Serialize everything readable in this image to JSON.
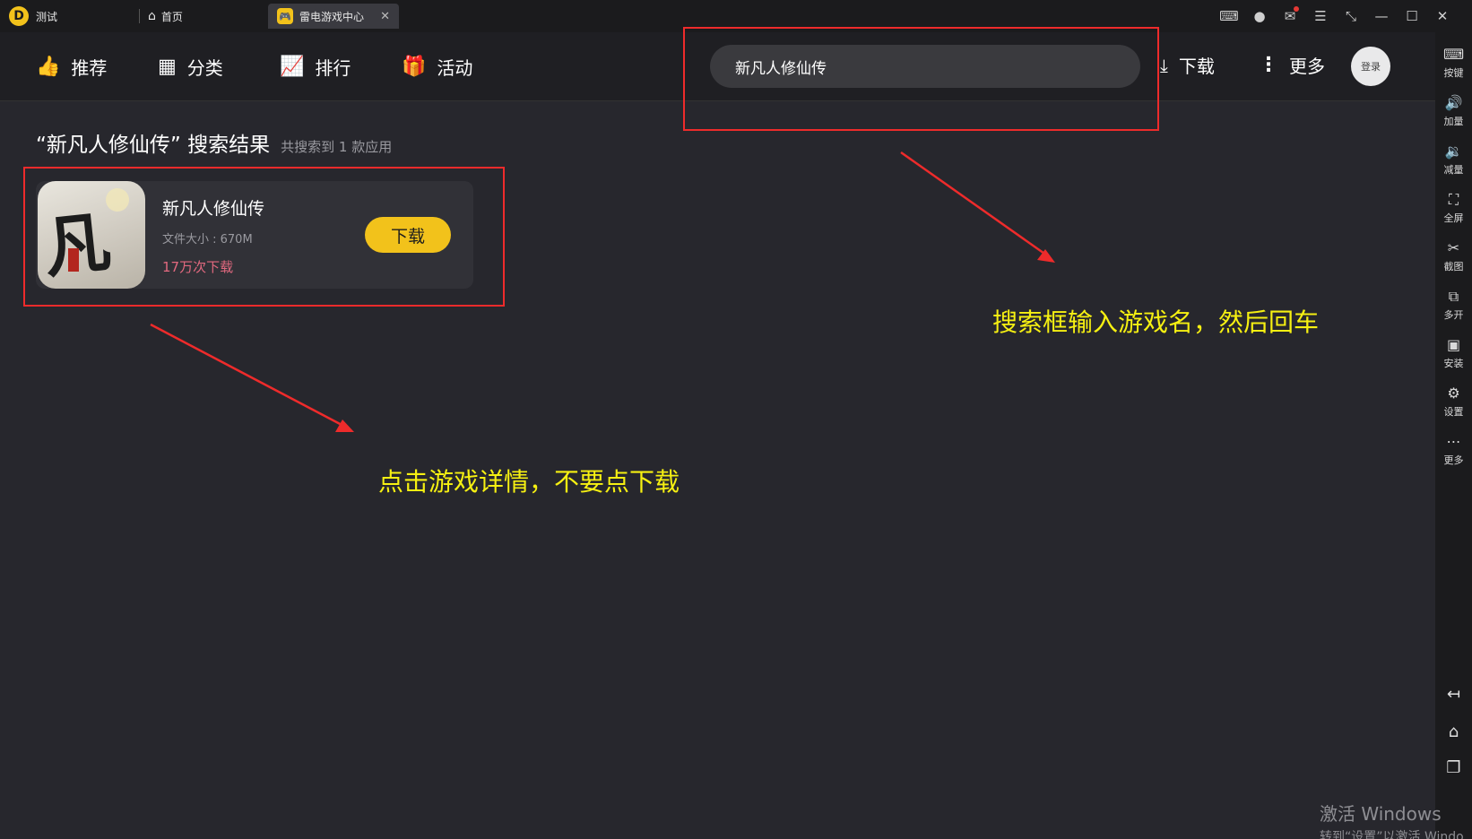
{
  "titlebar": {
    "app_tab": "测试",
    "home_tab": "首页",
    "active_tab": "雷电游戏中心",
    "close_glyph": "✕",
    "controls": [
      "gamepad-icon",
      "avatar-icon",
      "mail-icon",
      "menu-icon",
      "shrink-icon",
      "minimize-icon",
      "maximize-icon",
      "close-icon"
    ]
  },
  "nav": {
    "items": [
      {
        "label": "推荐",
        "icon": "thumbs-up-icon"
      },
      {
        "label": "分类",
        "icon": "grid-icon"
      },
      {
        "label": "排行",
        "icon": "chart-icon"
      },
      {
        "label": "活动",
        "icon": "gift-icon"
      }
    ],
    "search_value": "新凡人修仙传",
    "download_label": "下载",
    "more_label": "更多",
    "login_label": "登录"
  },
  "sidebar": {
    "items": [
      {
        "label": "按键",
        "icon": "keyboard-icon"
      },
      {
        "label": "加量",
        "icon": "volume-up-icon"
      },
      {
        "label": "减量",
        "icon": "volume-down-icon"
      },
      {
        "label": "全屏",
        "icon": "fullscreen-icon"
      },
      {
        "label": "截图",
        "icon": "scissors-icon"
      },
      {
        "label": "多开",
        "icon": "multi-instance-icon"
      },
      {
        "label": "安装",
        "icon": "apk-icon"
      },
      {
        "label": "设置",
        "icon": "gear-icon"
      },
      {
        "label": "更多",
        "icon": "more-icon"
      }
    ],
    "bottom": [
      "back-icon",
      "home-icon",
      "recent-apps-icon"
    ]
  },
  "results": {
    "title": "“新凡人修仙传” 搜索结果",
    "count_text": "共搜索到 1 款应用",
    "app": {
      "name": "新凡人修仙传",
      "size": "文件大小 : 670M",
      "downloads": "17万次下载",
      "button": "下载",
      "icon_glyph": "凡人"
    }
  },
  "annotations": {
    "note_search": "搜索框输入游戏名，然后回车",
    "note_click": "点击游戏详情，不要点下载",
    "color": "#f6f012",
    "box_color": "#ee2b2b"
  },
  "watermark": {
    "line1": "激活 Windows",
    "line2": "转到“设置”以激活 Windo"
  }
}
